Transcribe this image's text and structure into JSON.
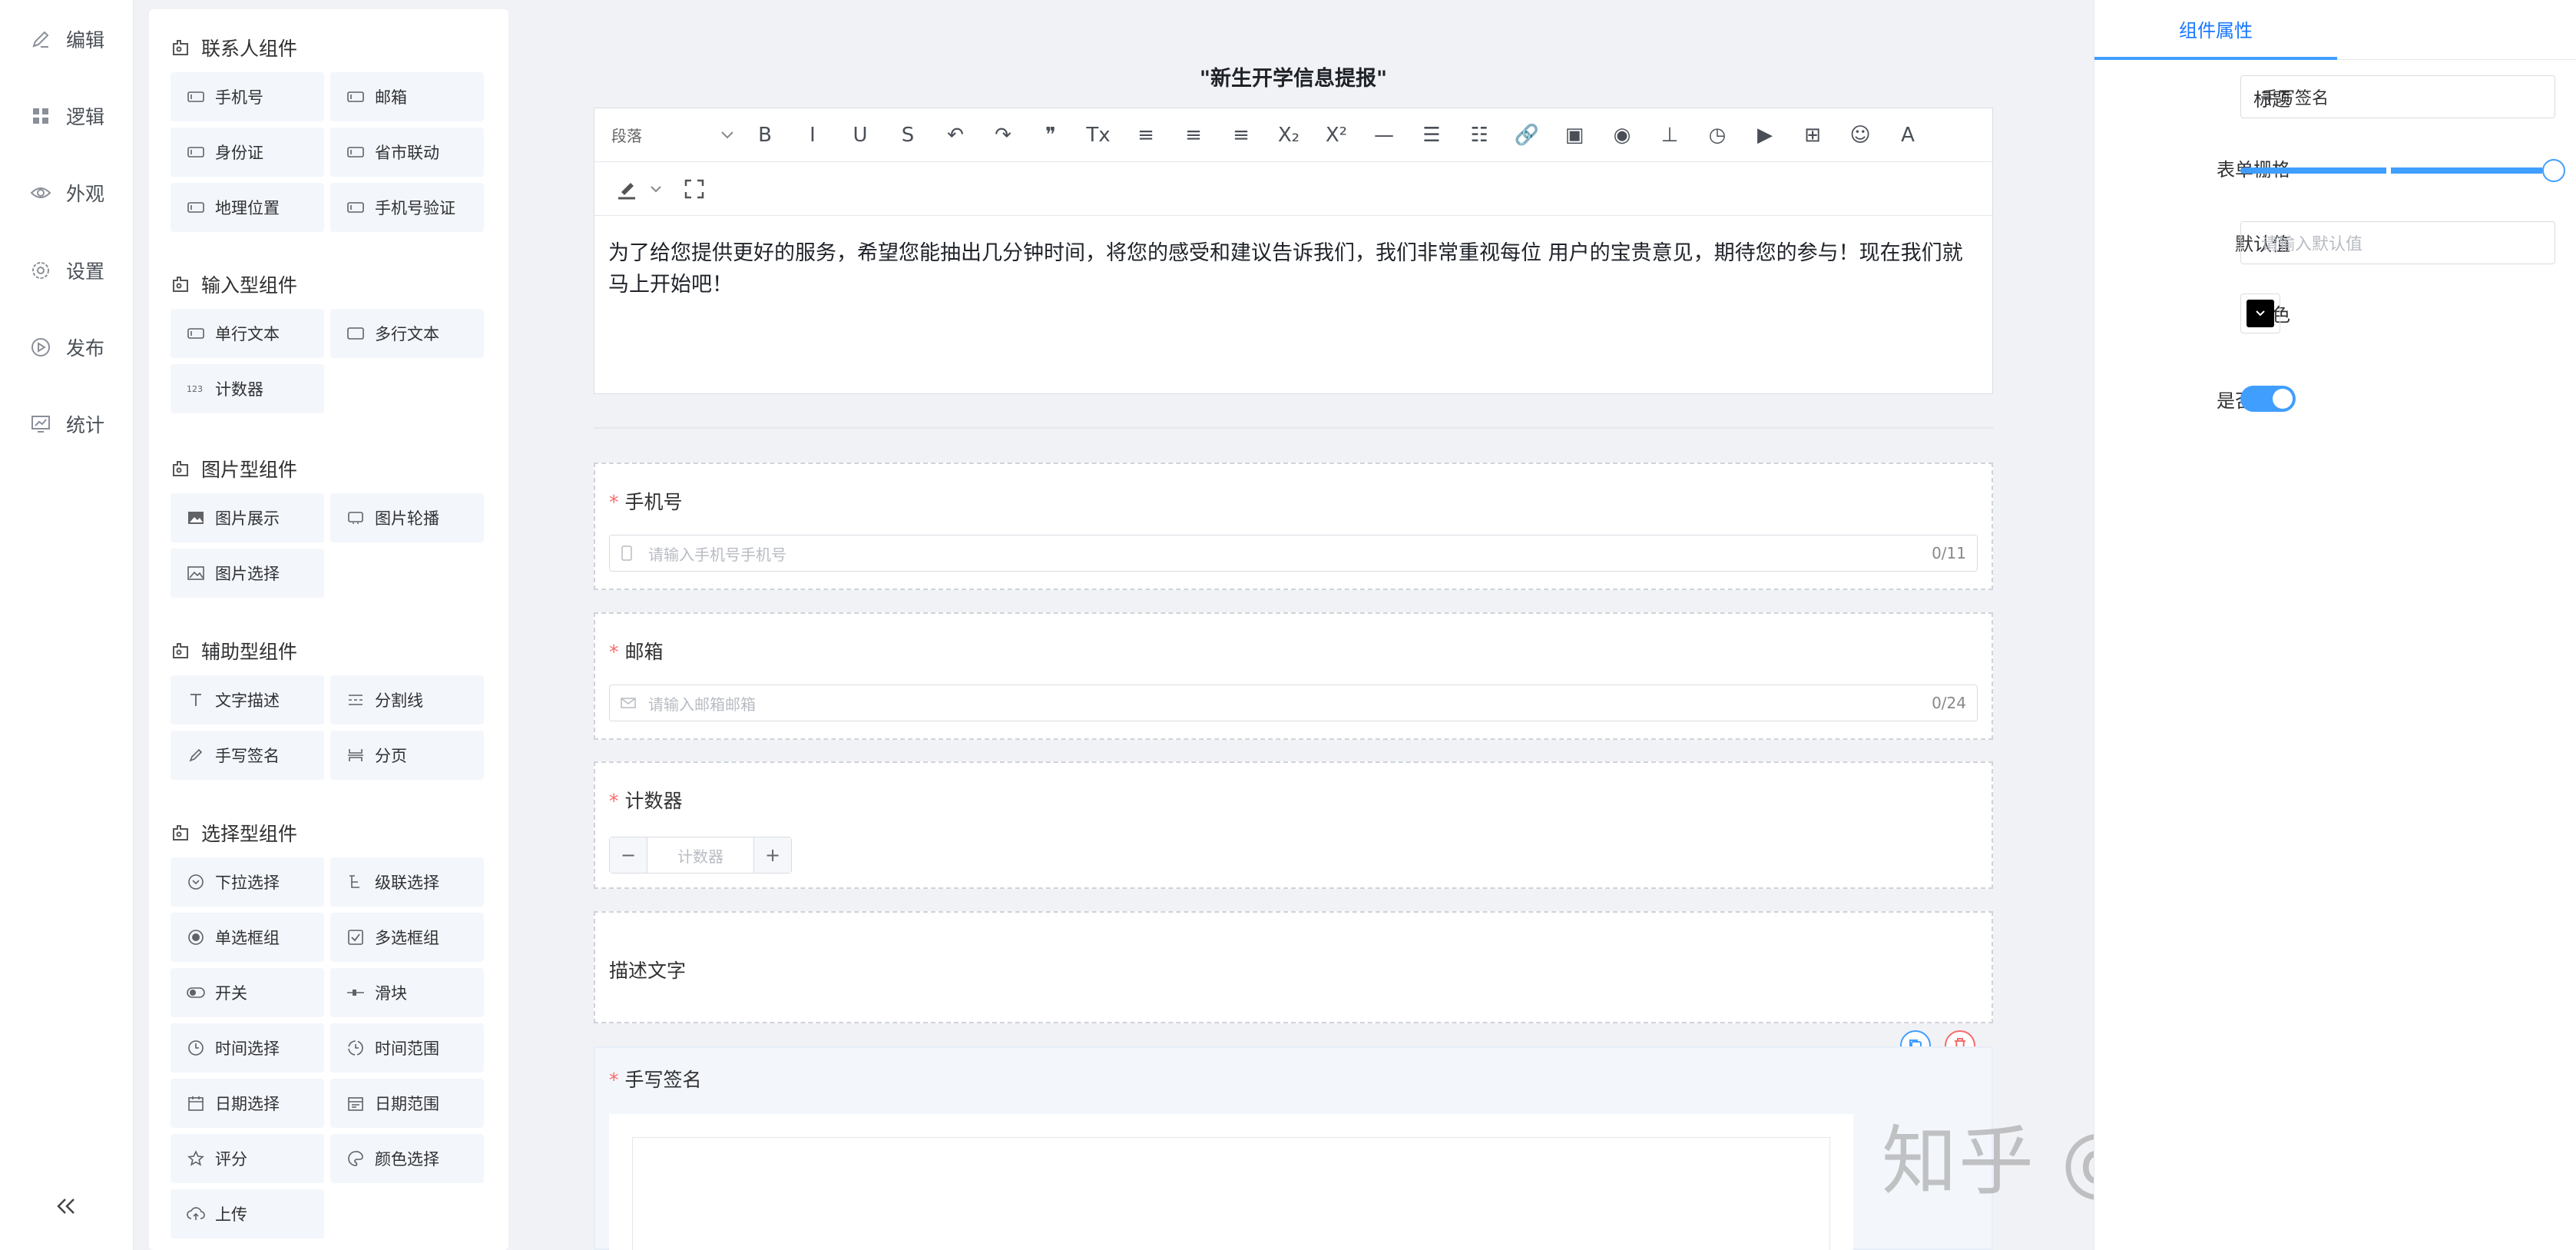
{
  "nav": {
    "items": [
      {
        "label": "编辑",
        "icon": "edit-icon"
      },
      {
        "label": "逻辑",
        "icon": "grid-icon"
      },
      {
        "label": "外观",
        "icon": "eye-icon"
      },
      {
        "label": "设置",
        "icon": "gear-icon"
      },
      {
        "label": "发布",
        "icon": "play-icon"
      },
      {
        "label": "统计",
        "icon": "chart-icon"
      }
    ],
    "collapse": "«"
  },
  "panel": {
    "groups": [
      {
        "title": "联系人组件",
        "items": [
          {
            "label": "手机号",
            "icon": "input-icon"
          },
          {
            "label": "邮箱",
            "icon": "input-icon"
          },
          {
            "label": "身份证",
            "icon": "input-icon"
          },
          {
            "label": "省市联动",
            "icon": "input-icon"
          },
          {
            "label": "地理位置",
            "icon": "input-icon"
          },
          {
            "label": "手机号验证",
            "icon": "input-icon"
          }
        ]
      },
      {
        "title": "输入型组件",
        "items": [
          {
            "label": "单行文本",
            "icon": "input-icon"
          },
          {
            "label": "多行文本",
            "icon": "textarea-icon"
          },
          {
            "label": "计数器",
            "icon": "counter-icon"
          }
        ]
      },
      {
        "title": "图片型组件",
        "items": [
          {
            "label": "图片展示",
            "icon": "image-icon"
          },
          {
            "label": "图片轮播",
            "icon": "carousel-icon"
          },
          {
            "label": "图片选择",
            "icon": "image-select-icon"
          }
        ]
      },
      {
        "title": "辅助型组件",
        "items": [
          {
            "label": "文字描述",
            "icon": "text-icon"
          },
          {
            "label": "分割线",
            "icon": "divider-icon"
          },
          {
            "label": "手写签名",
            "icon": "pen-icon"
          },
          {
            "label": "分页",
            "icon": "page-break-icon"
          }
        ]
      },
      {
        "title": "选择型组件",
        "items": [
          {
            "label": "下拉选择",
            "icon": "dropdown-icon"
          },
          {
            "label": "级联选择",
            "icon": "cascader-icon"
          },
          {
            "label": "单选框组",
            "icon": "radio-icon"
          },
          {
            "label": "多选框组",
            "icon": "checkbox-icon"
          },
          {
            "label": "开关",
            "icon": "toggle-icon"
          },
          {
            "label": "滑块",
            "icon": "slider-icon"
          },
          {
            "label": "时间选择",
            "icon": "clock-icon"
          },
          {
            "label": "时间范围",
            "icon": "clock-range-icon"
          },
          {
            "label": "日期选择",
            "icon": "calendar-icon"
          },
          {
            "label": "日期范围",
            "icon": "calendar-range-icon"
          },
          {
            "label": "评分",
            "icon": "star-icon"
          },
          {
            "label": "颜色选择",
            "icon": "palette-icon"
          },
          {
            "label": "上传",
            "icon": "upload-icon"
          }
        ]
      }
    ]
  },
  "form": {
    "title": "\"新生开学信息提报\"",
    "toolbar": {
      "paragraph": "段落",
      "buttons": [
        "B",
        "I",
        "U",
        "S",
        "↶",
        "↷",
        "❞",
        "Tx",
        "≡",
        "≡",
        "≡",
        "X₂",
        "X²",
        "—",
        "☰",
        "☷",
        "🔗",
        "▣",
        "◉",
        "⊥",
        "◷",
        "▶",
        "⊞",
        "☺",
        "A"
      ],
      "row2": [
        "✎",
        "⛶"
      ]
    },
    "intro": "为了给您提供更好的服务，希望您能抽出几分钟时间，将您的感受和建议告诉我们，我们非常重视每位 用户的宝贵意见，期待您的参与！现在我们就马上开始吧！",
    "fields": {
      "phone": {
        "label": "手机号",
        "placeholder": "请输入手机号手机号",
        "count": "0/11"
      },
      "email": {
        "label": "邮箱",
        "placeholder": "请输入邮箱邮箱",
        "count": "0/24"
      },
      "counter": {
        "label": "计数器",
        "minus": "−",
        "plus": "+",
        "placeholder": "计数器"
      },
      "desc": {
        "text": "描述文字"
      },
      "signature": {
        "label": "手写签名"
      }
    },
    "required_mark": "*"
  },
  "watermark": "知乎 @程序员小美",
  "props": {
    "tab": "组件属性",
    "title_label": "标题",
    "title_value": "手写签名",
    "grid_label": "表单栅格",
    "grid_value": 24,
    "default_label": "默认值",
    "default_placeholder": "请输入默认值",
    "color_label": "颜色",
    "color_value": "#000000",
    "required_label": "是否必填",
    "required_on": true,
    "accent": "#409eff"
  }
}
